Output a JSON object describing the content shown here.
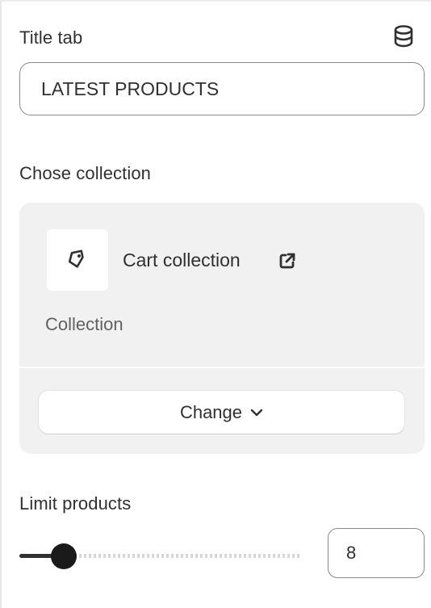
{
  "title_tab": {
    "label": "Title tab",
    "value": "LATEST PRODUCTS",
    "icon": "database-icon"
  },
  "collection": {
    "label": "Chose collection",
    "name": "Cart collection",
    "type": "Collection",
    "thumb_icon": "tag-icon",
    "link_icon": "external-link-icon",
    "change_label": "Change",
    "change_icon": "chevron-down-icon"
  },
  "limit": {
    "label": "Limit products",
    "value": "8",
    "slider_fraction": 0.15
  },
  "colors": {
    "text": "#303030",
    "card_bg": "#f1f1f1",
    "thumb": "#1a1a1a"
  }
}
